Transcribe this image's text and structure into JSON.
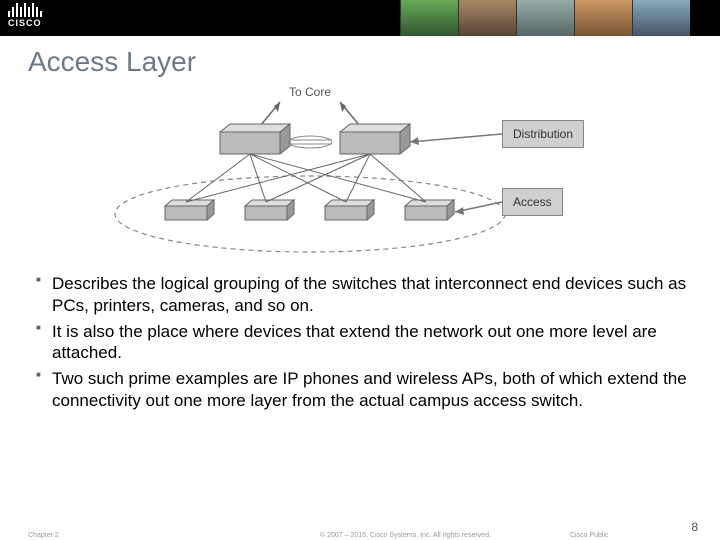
{
  "header": {
    "brand": "CISCO"
  },
  "title": "Access Layer",
  "diagram": {
    "to_core": "To Core",
    "dist_label": "Distribution",
    "access_label": "Access"
  },
  "bullets": [
    "Describes the logical grouping of the switches that interconnect end devices such as PCs, printers, cameras, and so on.",
    "It is also the place where devices that extend the network out one more level are attached.",
    "Two such prime examples are IP phones and wireless APs, both of which extend the connectivity out one more layer from the actual campus access switch."
  ],
  "footer": {
    "chapter": "Chapter 2",
    "copyright": "© 2007 – 2016, Cisco Systems, Inc. All rights reserved.",
    "public": "Cisco Public",
    "page": "8"
  }
}
